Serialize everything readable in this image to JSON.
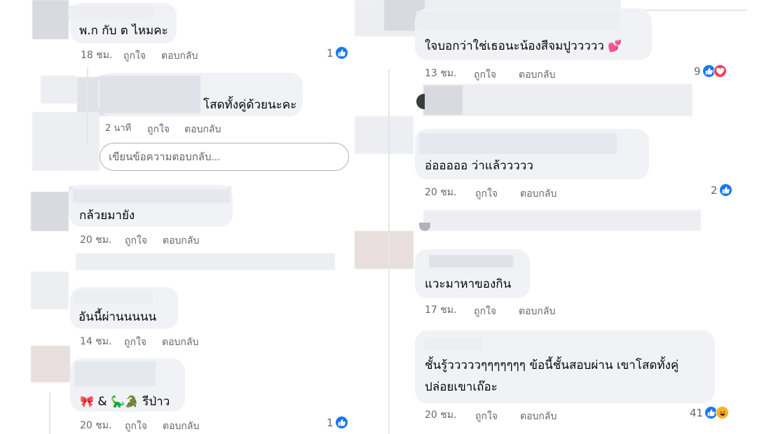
{
  "left_column": {
    "comment_1": {
      "text": "พ.ก กับ ต ไหมคะ",
      "time": "18 ชม.",
      "like_action": "ถูกใจ",
      "reply_action": "ตอบกลับ",
      "reaction_count": "1",
      "reaction_types": [
        "like"
      ]
    },
    "reply_1": {
      "text": "โสดทั้งคู่ด้วยนะคะ",
      "time": "2 นาที",
      "like_action": "ถูกใจ",
      "reply_action": "ตอบกลับ"
    },
    "reply_input": {
      "placeholder": "เขียนข้อความตอบกลับ..."
    },
    "comment_2": {
      "text": "กล้วยมายัง",
      "time": "20 ชม.",
      "like_action": "ถูกใจ",
      "reply_action": "ตอบกลับ"
    },
    "comment_3": {
      "text": "อันนี้ผ่านนนนน",
      "time": "14 ชม.",
      "like_action": "ถูกใจ",
      "reply_action": "ตอบกลับ"
    },
    "comment_4": {
      "text_suffix": "& ",
      "text_end": "รีป่าว",
      "emoji_1": "🎀",
      "emoji_2": "🦕🐊",
      "time": "20 ชม.",
      "like_action": "ถูกใจ",
      "reply_action": "ตอบกลับ",
      "reaction_count": "1",
      "reaction_types": [
        "like"
      ]
    }
  },
  "right_column": {
    "comment_1": {
      "text": "ใจบอกว่าใช่เธอนะน้องสีจมปูววววว",
      "emoji": "💕",
      "time": "13 ชม.",
      "like_action": "ถูกใจ",
      "reply_action": "ตอบกลับ",
      "reaction_count": "9",
      "reaction_types": [
        "like",
        "love"
      ]
    },
    "comment_2": {
      "text": "อ่อออออ ว่าแล้ววววว",
      "time": "20 ชม.",
      "like_action": "ถูกใจ",
      "reply_action": "ตอบกลับ",
      "reaction_count": "2",
      "reaction_types": [
        "like"
      ]
    },
    "comment_3": {
      "text": "แวะมาหาของกิน",
      "time": "17 ชม.",
      "like_action": "ถูกใจ",
      "reply_action": "ตอบกลับ"
    },
    "comment_4": {
      "line_1": "ชั้นรู้วววววๆๆๆๆๆๆๆ ข้อนี้ชั้นสอบผ่าน เขาโสดทั้งคู่",
      "line_2": "ปล่อยเขาเถ๊อะ",
      "time": "20 ชม.",
      "like_action": "ถูกใจ",
      "reply_action": "ตอบกลับ",
      "reaction_count": "41",
      "reaction_types": [
        "like",
        "haha"
      ]
    }
  },
  "icons": {
    "like": "thumbs-up-icon",
    "love": "heart-icon",
    "haha": "laughing-face-icon"
  },
  "colors": {
    "like_blue": "#1877f2",
    "love_red": "#f33e58",
    "haha_yellow": "#f7b125",
    "bubble_gray": "#f0f2f5",
    "meta_gray": "#65676b"
  }
}
